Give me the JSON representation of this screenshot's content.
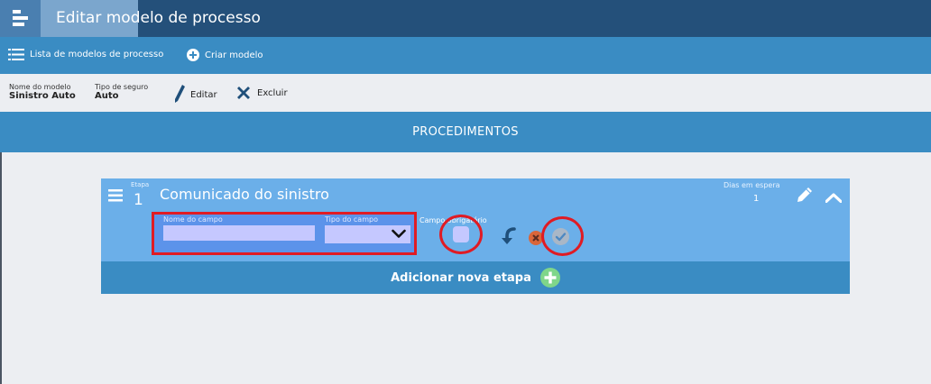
{
  "window": {
    "title": "Editar modelo de processo",
    "icon": "process-menu-icon"
  },
  "nav": {
    "list_label": "Lista de modelos de processo",
    "list_icon": "list-icon",
    "create_label": "Criar modelo",
    "create_icon": "plus-circle-icon"
  },
  "model_info": {
    "name_label": "Nome do modelo",
    "name_value": "Sinistro Auto",
    "type_label": "Tipo de seguro",
    "type_value": "Auto",
    "edit_label": "Editar",
    "edit_icon": "pencil-icon",
    "delete_label": "Excluir",
    "delete_icon": "close-x-icon"
  },
  "section": {
    "title": "PROCEDIMENTOS"
  },
  "stage": {
    "stage_label": "Etapa",
    "stage_number": "1",
    "title": "Comunicado do sinistro",
    "days_label": "Dias em espera",
    "days_value": "1",
    "field_name_label": "Nome do campo",
    "field_name_value": "",
    "field_type_label": "Tipo do campo",
    "field_type_value": "",
    "required_label": "Campo obrigatório"
  },
  "add_stage": {
    "label": "Adicionar nova etapa",
    "icon": "plus-circle-icon"
  },
  "colors": {
    "titlebar": "#24507a",
    "primary_bar": "#3a8cc3",
    "stage_card": "#6bafe9",
    "highlight_ring": "#e01b24",
    "add_icon": "#7fd68a",
    "cancel_icon": "#d9663a"
  }
}
